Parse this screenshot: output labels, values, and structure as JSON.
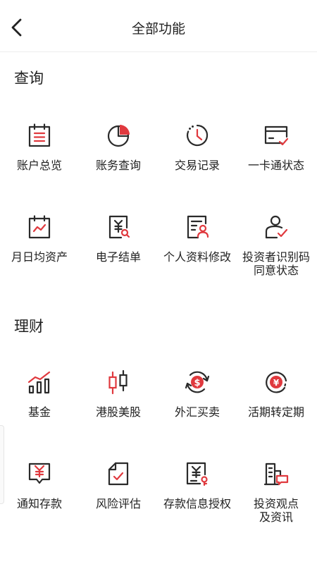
{
  "header": {
    "title": "全部功能"
  },
  "sections": [
    {
      "title": "查询",
      "items": [
        {
          "label": "账户总览",
          "icon": "calendar-list-icon"
        },
        {
          "label": "账务查询",
          "icon": "pie-chart-icon"
        },
        {
          "label": "交易记录",
          "icon": "history-clock-icon"
        },
        {
          "label": "一卡通状态",
          "icon": "card-check-icon"
        },
        {
          "label": "月日均资产",
          "icon": "calendar-trend-icon"
        },
        {
          "label": "电子结单",
          "icon": "yen-statement-search-icon"
        },
        {
          "label": "个人资料修改",
          "icon": "profile-edit-icon"
        },
        {
          "label": "投资者识别码\n同意状态",
          "icon": "user-check-icon"
        }
      ]
    },
    {
      "title": "理财",
      "items": [
        {
          "label": "基金",
          "icon": "fund-bar-chart-icon"
        },
        {
          "label": "港股美股",
          "icon": "candlestick-icon"
        },
        {
          "label": "外汇买卖",
          "icon": "dollar-exchange-icon"
        },
        {
          "label": "活期转定期",
          "icon": "yen-circle-icon"
        },
        {
          "label": "通知存款",
          "icon": "yen-notice-icon"
        },
        {
          "label": "风险评估",
          "icon": "document-check-icon"
        },
        {
          "label": "存款信息授权",
          "icon": "yen-document-lock-icon"
        },
        {
          "label": "投资观点\n及资讯",
          "icon": "buildings-chat-icon"
        }
      ]
    }
  ]
}
